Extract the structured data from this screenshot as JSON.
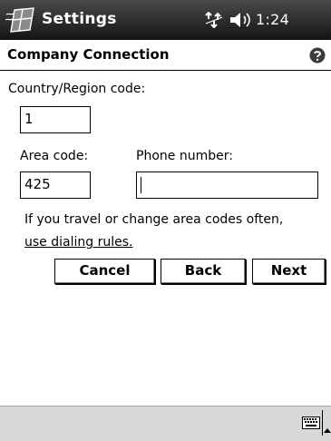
{
  "status_bar": {
    "app_title": "Settings",
    "time": "1:24",
    "icons": [
      "windows-start-flag-icon",
      "connectivity-icon",
      "speaker-icon"
    ]
  },
  "header": {
    "title": "Company Connection",
    "help_icon": "help-icon"
  },
  "form": {
    "country_label": "Country/Region code:",
    "country_value": "1",
    "area_label": "Area code:",
    "area_value": "425",
    "phone_label": "Phone number:",
    "phone_value": ""
  },
  "info": {
    "text": "If you travel or change area codes often,",
    "link": "use dialing rules."
  },
  "buttons": {
    "cancel": "Cancel",
    "back": "Back",
    "next": "Next"
  },
  "taskbar": {
    "icons": [
      "keyboard-icon",
      "sip-arrow-icon"
    ]
  },
  "colors": {
    "titlebar": "#1e1e1e",
    "taskbar": "#d8d8d8"
  }
}
